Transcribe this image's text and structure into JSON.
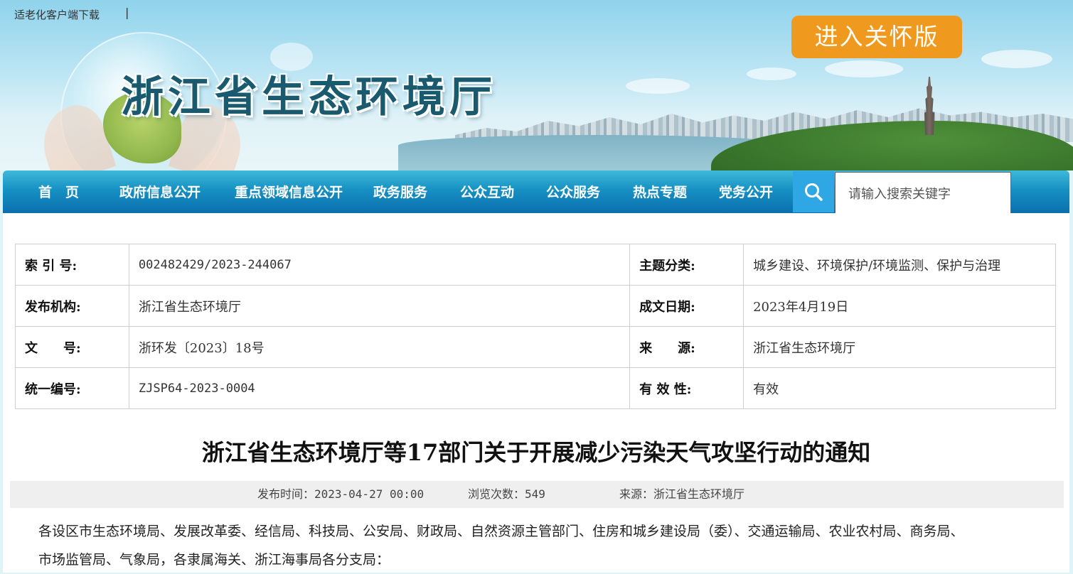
{
  "header": {
    "elder_link": "适老化客户端下载",
    "separator": "|",
    "site_title": "浙江省生态环境厅",
    "care_button": "进入关怀版"
  },
  "nav": {
    "items": [
      {
        "label": "首　页"
      },
      {
        "label": "政府信息公开"
      },
      {
        "label": "重点领域信息公开"
      },
      {
        "label": "政务服务"
      },
      {
        "label": "公众互动"
      },
      {
        "label": "公众服务"
      },
      {
        "label": "热点专题"
      },
      {
        "label": "党务公开"
      }
    ],
    "search_icon": "search-icon",
    "search_placeholder": "请输入搜索关键字"
  },
  "meta": {
    "rows": [
      {
        "l1": "索 引 号:",
        "v1": "002482429/2023-244067",
        "l2": "主题分类:",
        "v2": "城乡建设、环境保护/环境监测、保护与治理"
      },
      {
        "l1": "发布机构:",
        "v1": "浙江省生态环境厅",
        "l2": "成文日期:",
        "v2": "2023年4月19日"
      },
      {
        "l1": "文　　号:",
        "v1": "浙环发〔2023〕18号",
        "l2": "来　　源:",
        "v2": "浙江省生态环境厅"
      },
      {
        "l1": "统一编号:",
        "v1": "ZJSP64-2023-0004",
        "l2": "有 效 性:",
        "v2": "有效"
      }
    ]
  },
  "article": {
    "title": "浙江省生态环境厅等17部门关于开展减少污染天气攻坚行动的通知",
    "publish_time": "发布时间：2023-04-27 00:00",
    "views": "浏览次数：549",
    "source": "来源：浙江省生态环境厅",
    "body": "各设区市生态环境局、发展改革委、经信局、科技局、公安局、财政局、自然资源主管部门、住房和城乡建设局（委）、交通运输局、农业农村局、商务局、市场监管局、气象局，各隶属海关、浙江海事局各分支局："
  },
  "colors": {
    "nav_top": "#3fb9d9",
    "nav_bottom": "#0b6fae",
    "care_button": "#f0991f",
    "search_button": "#2fa7e4"
  }
}
